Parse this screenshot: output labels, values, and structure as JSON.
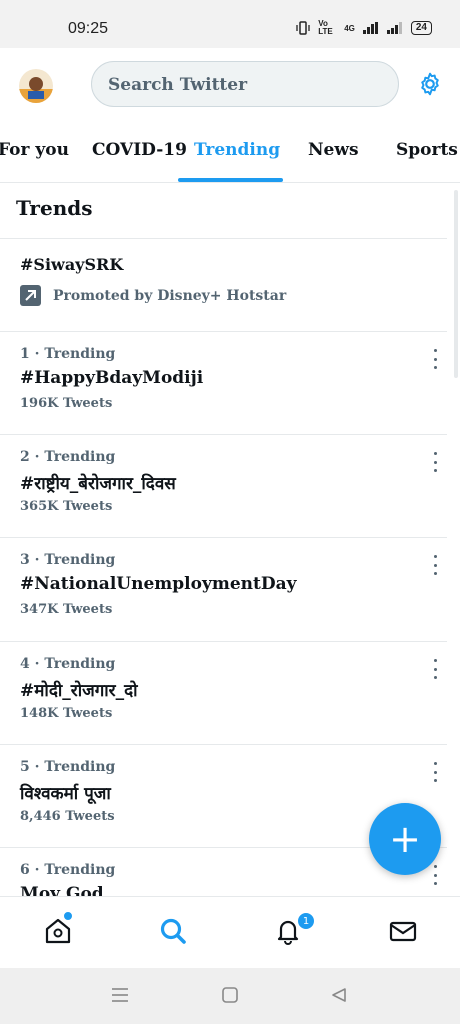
{
  "status_bar": {
    "time": "09:25",
    "network": "4G",
    "volte": "Vo LTE",
    "battery": "24"
  },
  "header": {
    "search_placeholder": "Search Twitter"
  },
  "tabs": [
    {
      "label": "For you"
    },
    {
      "label": "COVID-19"
    },
    {
      "label": "Trending"
    },
    {
      "label": "News"
    },
    {
      "label": "Sports"
    }
  ],
  "section_title": "Trends",
  "promoted": {
    "tag": "#SiwaySRK",
    "text": "Promoted by Disney+ Hotstar"
  },
  "trends": [
    {
      "meta": "1 · Trending",
      "name": "#HappyBdayModiji",
      "count": "196K Tweets"
    },
    {
      "meta": "2 · Trending",
      "name": "#राष्ट्रीय_बेरोजगार_दिवस",
      "count": "365K Tweets"
    },
    {
      "meta": "3 · Trending",
      "name": "#NationalUnemploymentDay",
      "count": "347K Tweets"
    },
    {
      "meta": "4 · Trending",
      "name": "#मोदी_रोजगार_दो",
      "count": "148K Tweets"
    },
    {
      "meta": "5 · Trending",
      "name": "विश्वकर्मा पूजा",
      "count": "8,446 Tweets"
    },
    {
      "meta": "6 · Trending",
      "name": "Moy God",
      "count": ""
    }
  ],
  "fab_label": "+",
  "notifications_badge": "1",
  "colors": {
    "accent": "#1d9bf0",
    "text": "#0f1419",
    "secondary": "#536471"
  },
  "icons": [
    "home-icon",
    "search-icon",
    "bell-icon",
    "mail-icon",
    "gear-icon",
    "promoted-arrow-icon",
    "more-icon"
  ]
}
